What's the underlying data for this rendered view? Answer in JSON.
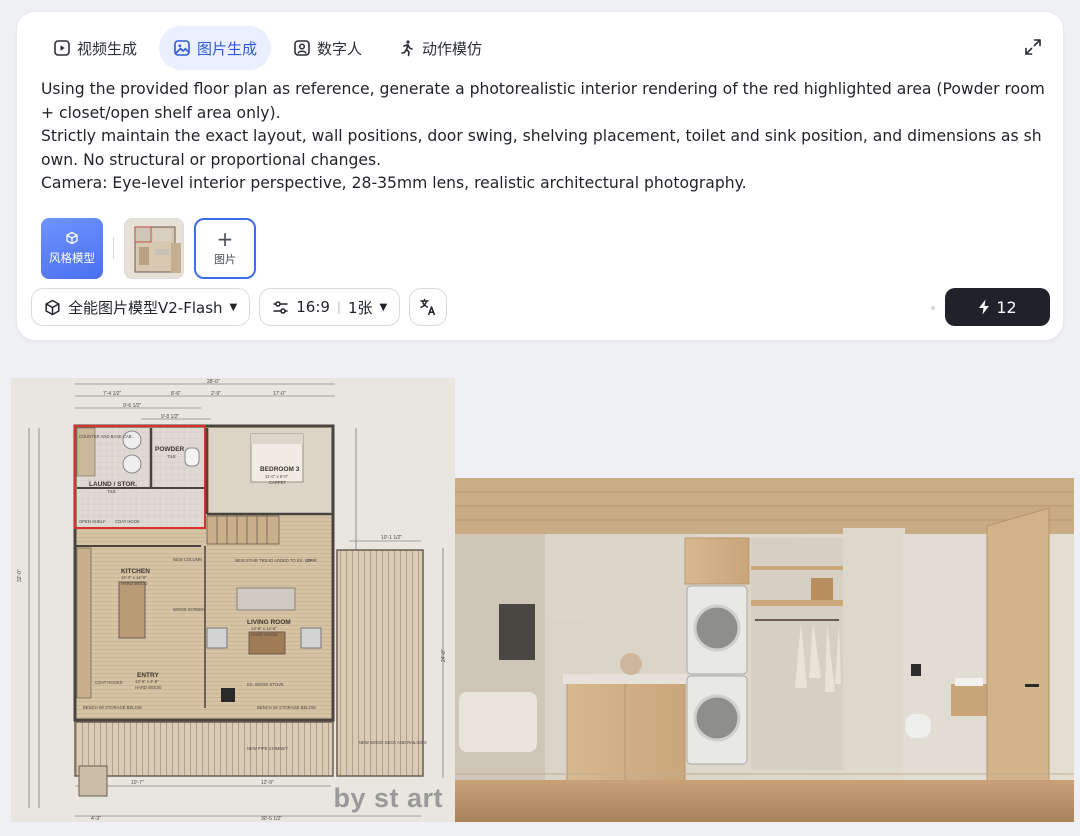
{
  "tabs": [
    {
      "label": "视频生成",
      "icon": "video-icon"
    },
    {
      "label": "图片生成",
      "icon": "image-icon",
      "active": true
    },
    {
      "label": "数字人",
      "icon": "person-frame-icon"
    },
    {
      "label": "动作模仿",
      "icon": "running-person-icon"
    }
  ],
  "prompt": {
    "text": "Using the provided floor plan as reference, generate a photorealistic interior rendering of the red highlighted area (Powder room + closet/open shelf area only).\nStrictly maintain the exact layout, wall positions, door swing, shelving placement, toilet and sink position, and dimensions as shown. No structural or proportional changes.\nCamera: Eye-level interior perspective, 28-35mm lens, realistic architectural photography."
  },
  "attachments": {
    "style_button_label": "风格模型",
    "add_image_label": "图片"
  },
  "toolbar": {
    "model_label": "全能图片模型V2-Flash",
    "ratio_label": "16:9",
    "count_label": "1张",
    "generate_count": "12"
  },
  "floorplan": {
    "watermark": "by st art",
    "rooms": {
      "powder": "POWDER",
      "powder_sub": "TILE",
      "laundry": "LAUND / STOR.",
      "laundry_sub": "TILE",
      "bedroom": "BEDROOM 3",
      "bedroom_sub1": "11'-0\" x 8'-0\"",
      "bedroom_sub2": "CARPET",
      "kitchen": "KITCHEN",
      "kitchen_sub1": "10'-0\" x 14'-8\"",
      "kitchen_sub2": "HARD WOOD",
      "living": "LIVING ROOM",
      "living_sub1": "13'-8\" x 14'-8\"",
      "living_sub2": "HARD WOOD",
      "entry": "ENTRY",
      "entry_sub1": "13'-8\" x 3'-8\"",
      "entry_sub2": "HARD WOOD",
      "counter": "COUNTER AND BASE CAB.",
      "open_shelf": "OPEN SHELF",
      "coat_hook": "COAT HOOK",
      "new_column": "NEW COLUMN",
      "wood_screen": "WOOD SCREEN",
      "new_stair": "NEW STAIR TREAD ADDED TO EX. STAIR",
      "up": "UP",
      "coat_hooks": "COAT HOOKS",
      "ex_wood_stove": "EX. WOOD STOVE",
      "bench_left": "BENCH W/ STORAGE BELOW",
      "bench_right": "BENCH W/ STORAGE BELOW",
      "new_pipe": "NEW PIPE CHIMNEY",
      "new_deck": "NEW WOOD DECK AND RAILINGS"
    },
    "dims": {
      "top_total": "28'-0\"",
      "top_a": "7'-4 1/2\"",
      "top_b": "8'-6\"",
      "top_c": "17'-0\"",
      "top_d": "2'-9\"",
      "top_e": "9'-8 1/2\"",
      "top_f": "9'-6 1/2\"",
      "left_total": "32'-0\"",
      "deck_w": "10'-1 1/2\"",
      "right_total": "24'-8\"",
      "bottom_a": "4'-3\"",
      "bottom_b": "30'-5 1/2\"",
      "bottom_c": "10'-7\"",
      "bottom_d": "12'-9\""
    }
  },
  "colors": {
    "active_tab_bg": "#eaf0ff",
    "active_tab_text": "#2f5bd6",
    "style_button": "#5b7ff5",
    "add_button_border": "#3d6ee8",
    "generate_button": "#1f2329",
    "highlight_red": "#d9322b"
  }
}
